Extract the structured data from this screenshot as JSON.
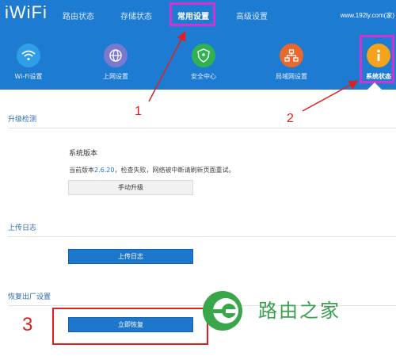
{
  "header": {
    "logo": "iWiFi",
    "nav": [
      "路由状态",
      "存储状态",
      "常用设置",
      "高级设置"
    ],
    "domain": "www.192ly.com(家)"
  },
  "icons": [
    {
      "label": "Wi-Fi设置",
      "color": "#2e9fe6",
      "icon": "wifi-icon"
    },
    {
      "label": "上网设置",
      "color": "#7a78cf",
      "icon": "globe-icon"
    },
    {
      "label": "安全中心",
      "color": "#2fb24f",
      "icon": "shield-icon"
    },
    {
      "label": "局域网设置",
      "color": "#e9682f",
      "icon": "network-icon"
    },
    {
      "label": "系统状态",
      "color": "#f5a31c",
      "icon": "info-icon"
    }
  ],
  "sections": {
    "upgrade": {
      "title": "升级检测",
      "sys_title": "系统版本",
      "desc_prefix": "当前版本",
      "version": "2.6.20",
      "desc_suffix": "，检查失败，网络被中断请刷新页面重试。",
      "button": "手动升级"
    },
    "log": {
      "title": "上传日志",
      "button": "上传日志"
    },
    "reset": {
      "title": "恢复出厂设置",
      "button": "立即恢复"
    }
  },
  "annotations": {
    "n1": "1",
    "n2": "2",
    "n3": "3"
  },
  "watermark": {
    "text": "路由之家"
  },
  "colors": {
    "header_bg": "#1d7bd2",
    "highlight": "#d62fd3",
    "annotation_red": "#e02020",
    "button_blue": "#1d77cc"
  }
}
